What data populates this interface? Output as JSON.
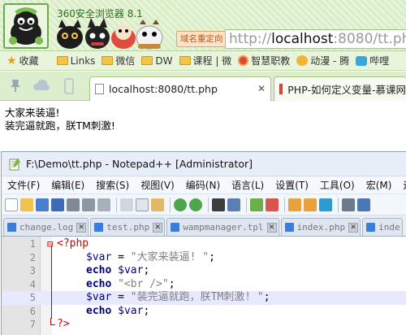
{
  "browser": {
    "title": "360安全浏览器 8.1",
    "redirect_label": "域名重定向",
    "url_scheme": "http://",
    "url_host": "localhost",
    "url_rest": ":8080/tt.php",
    "bookmarks": [
      {
        "label": "收藏",
        "icon": "star-icon"
      },
      {
        "label": "Links",
        "icon": "folder-icon"
      },
      {
        "label": "微信",
        "icon": "folder-icon"
      },
      {
        "label": "DW",
        "icon": "folder-icon"
      },
      {
        "label": "课程 | 微",
        "icon": "folder-icon"
      },
      {
        "label": "智慧职教",
        "icon": "smart-edu-icon"
      },
      {
        "label": "动漫 - 腾",
        "icon": "anime-icon"
      },
      {
        "label": "哔哩",
        "icon": "bilibili-icon"
      }
    ],
    "tabs": [
      {
        "label": "localhost:8080/tt.php",
        "active": true
      },
      {
        "label": "PHP-如何定义变量-慕课网",
        "active": false
      }
    ],
    "page_lines": [
      "大家来装逼!",
      "装完逼就跑，朕TM刺激!"
    ]
  },
  "npp": {
    "title": "F:\\Demo\\tt.php - Notepad++ [Administrator]",
    "menu": [
      "文件(F)",
      "编辑(E)",
      "搜索(S)",
      "视图(V)",
      "编码(N)",
      "语言(L)",
      "设置(T)",
      "工具(O)",
      "宏(M)",
      "运行"
    ],
    "file_tabs": [
      {
        "name": "change.log",
        "active": false
      },
      {
        "name": "test.php",
        "active": false
      },
      {
        "name": "wampmanager.tpl",
        "active": false
      },
      {
        "name": "index.php",
        "active": false
      },
      {
        "name": "inde",
        "active": false
      }
    ],
    "close_glyph": "✕",
    "fold_open": "⊟",
    "lines": [
      {
        "num": "1",
        "open": "<?php"
      },
      {
        "num": "2",
        "var": "$var",
        "eq": " = ",
        "str": "\"大家来装逼! \"",
        "semi": ";"
      },
      {
        "num": "3",
        "kw": "echo",
        "var": " $var",
        "semi": ";"
      },
      {
        "num": "4",
        "kw": "echo",
        "str": " \"<br />\"",
        "semi": ";"
      },
      {
        "num": "5",
        "var": "$var",
        "eq": " = ",
        "str": "\"装完逼就跑，朕TM刺激! \"",
        "semi": ";"
      },
      {
        "num": "6",
        "kw": "echo",
        "var": " $var",
        "semi": ";"
      },
      {
        "num": "7",
        "close": "?>"
      }
    ]
  },
  "colors": {
    "chrome_green": "#dbeec8",
    "php_tag": "#d00000",
    "keyword": "#000080",
    "string": "#808080",
    "current_line": "#e8e8ff"
  }
}
